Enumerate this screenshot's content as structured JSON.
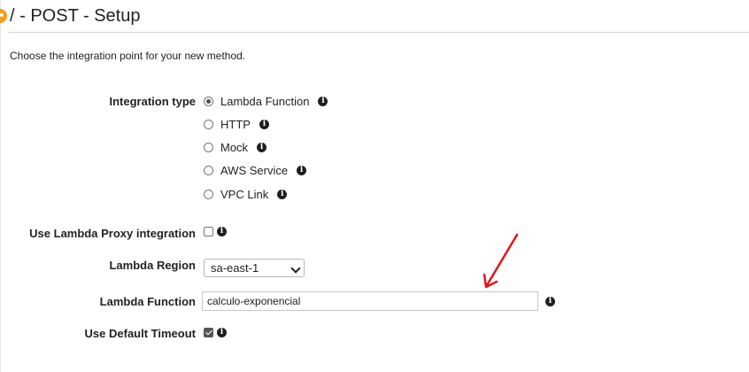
{
  "header": {
    "title": "/ - POST - Setup"
  },
  "intro_text": "Choose the integration point for your new method.",
  "integration_type": {
    "label": "Integration type",
    "options": [
      {
        "label": "Lambda Function",
        "selected": true
      },
      {
        "label": "HTTP",
        "selected": false
      },
      {
        "label": "Mock",
        "selected": false
      },
      {
        "label": "AWS Service",
        "selected": false
      },
      {
        "label": "VPC Link",
        "selected": false
      }
    ]
  },
  "proxy": {
    "label": "Use Lambda Proxy integration",
    "checked": false
  },
  "region": {
    "label": "Lambda Region",
    "value": "sa-east-1"
  },
  "function": {
    "label": "Lambda Function",
    "value": "calculo-exponencial"
  },
  "timeout": {
    "label": "Use Default Timeout",
    "checked": true
  },
  "icons": {
    "info": "i",
    "annotation": "red-arrow-icon"
  },
  "colors": {
    "accent": "#f19e1b",
    "annotation_red": "#e0161b"
  }
}
